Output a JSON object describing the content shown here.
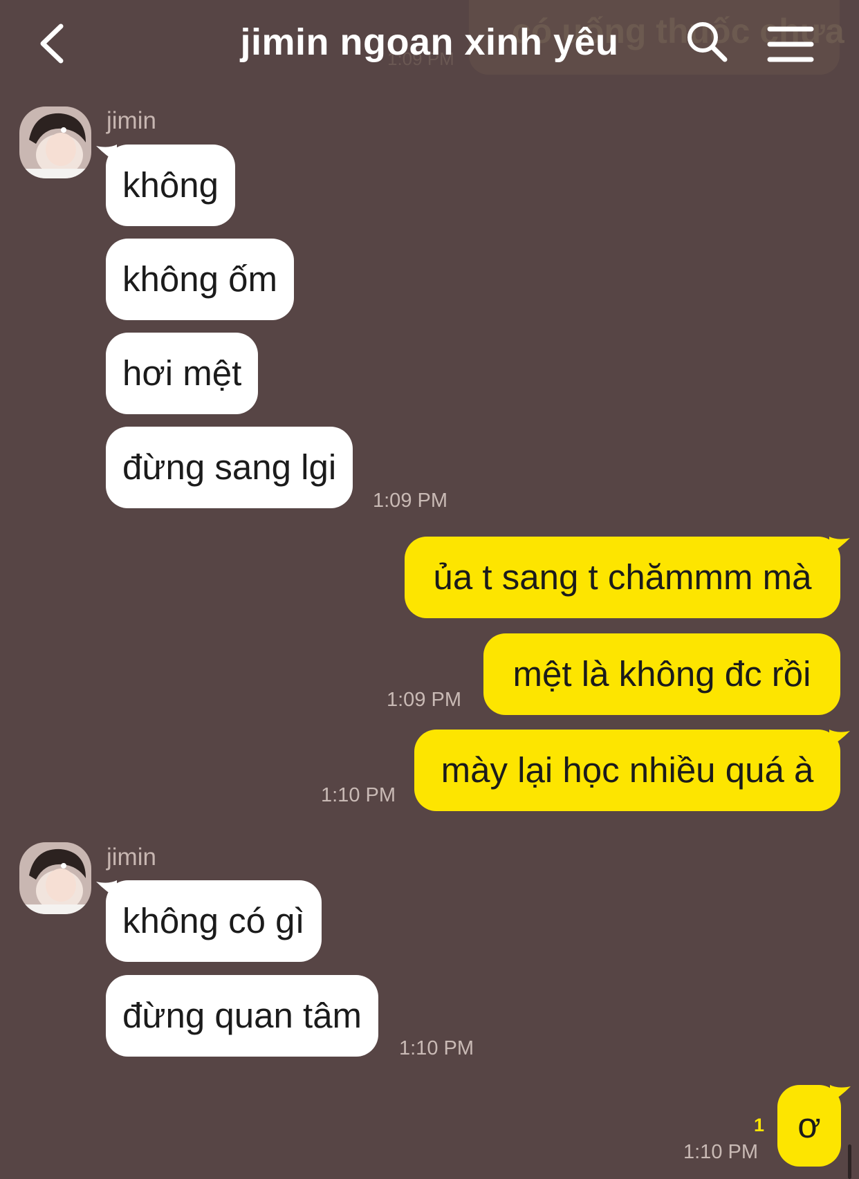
{
  "header": {
    "title": "jimin ngoan xinh yêu",
    "ghost_message": "có uống thuốc chưa",
    "ghost_time": "1:09 PM"
  },
  "groups": [
    {
      "sender": "jimin",
      "messages": [
        "không",
        "không ốm",
        "hơi mệt",
        "đừng sang lgi"
      ],
      "time": "1:09 PM"
    },
    {
      "outgoing": [
        "ủa t sang t chămmm mà",
        "mệt là không đc rồi",
        "mày lại học nhiều quá à"
      ],
      "times": [
        "1:09 PM",
        "1:10 PM"
      ]
    },
    {
      "sender": "jimin",
      "messages": [
        "không có gì",
        "đừng quan tâm"
      ],
      "time": "1:10 PM"
    },
    {
      "outgoing": [
        "ơ"
      ],
      "unread": "1",
      "time": "1:10 PM"
    }
  ],
  "colors": {
    "background": "#574545",
    "outgoing_bubble": "#fde500",
    "incoming_bubble": "#ffffff"
  }
}
